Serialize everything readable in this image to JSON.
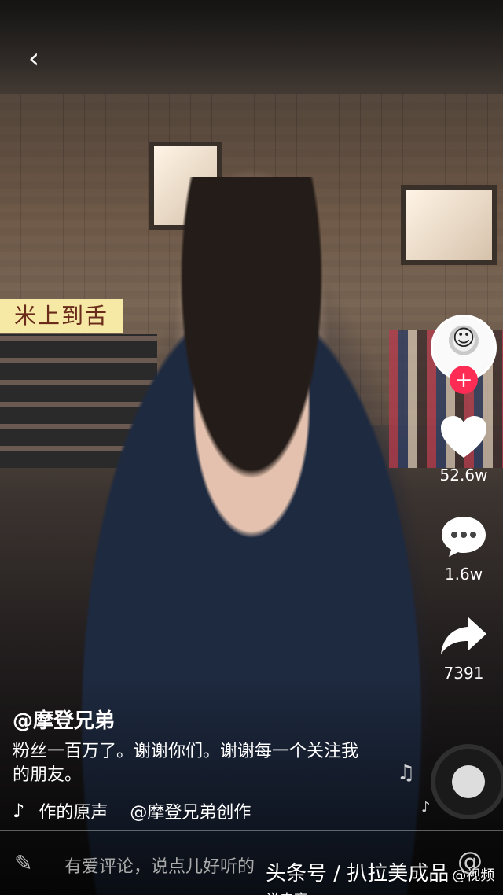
{
  "nav": {
    "back_icon": "chevron-left-icon"
  },
  "background_sign_text": "米上到舌",
  "rail": {
    "avatar_icon": "creator-avatar",
    "follow_icon": "plus-icon",
    "like_count": "52.6w",
    "comment_count": "1.6w",
    "share_count": "7391"
  },
  "caption": {
    "username": "@摩登兄弟",
    "description": "粉丝一百万了。谢谢你们。谢谢每一个关注我的朋友。",
    "music_track": "作的原声",
    "music_owner": "@摩登兄弟创作"
  },
  "comment_bar": {
    "placeholder": "有爱评论，说点儿好听的",
    "pen_icon": "pen-icon",
    "at_icon": "at-icon"
  },
  "watermark": {
    "text": "头条号 / 扒拉美成品",
    "sub": "@视频说电商"
  },
  "colors": {
    "follow_badge": "#fe2c55",
    "overlay_text": "#ffffff"
  }
}
